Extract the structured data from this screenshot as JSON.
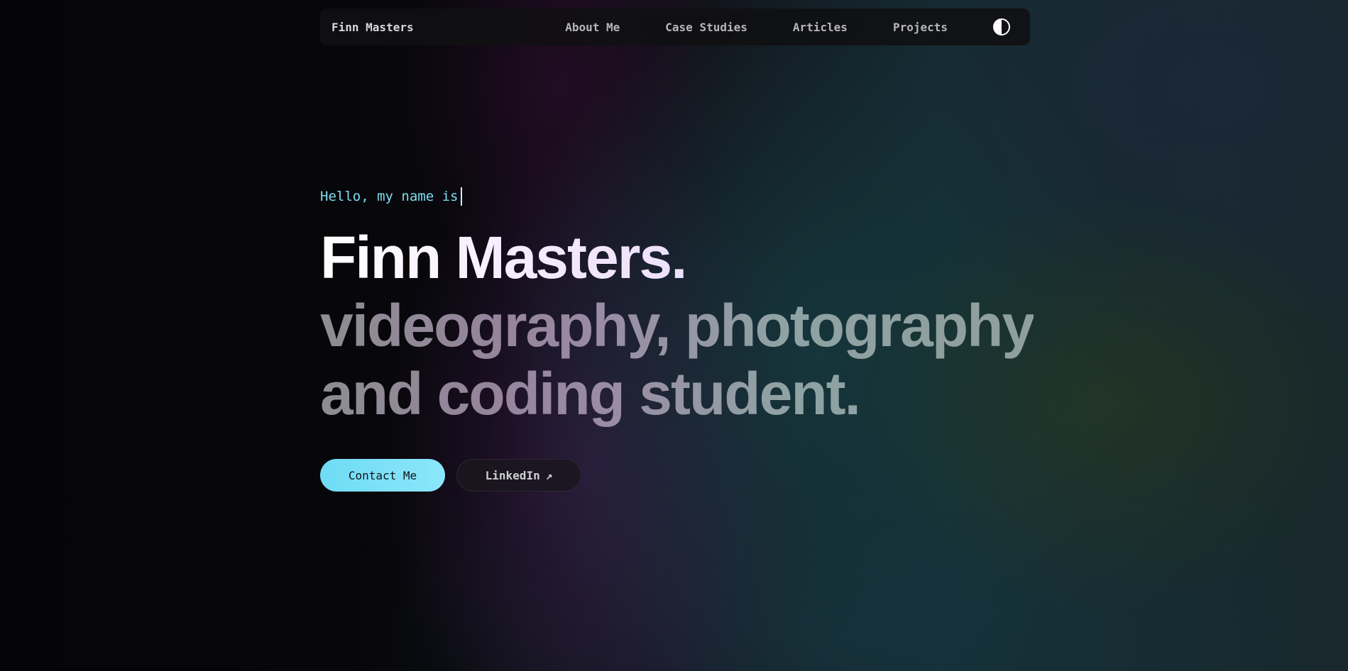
{
  "nav": {
    "brand": "Finn Masters",
    "links": [
      {
        "label": "About Me"
      },
      {
        "label": "Case Studies"
      },
      {
        "label": "Articles"
      },
      {
        "label": "Projects"
      }
    ],
    "theme_toggle_icon": "half-circle-contrast-icon"
  },
  "hero": {
    "greeting": "Hello, my name is",
    "name": "Finn Masters.",
    "tagline_line1": "videography, photography",
    "tagline_line2": "and coding student."
  },
  "actions": {
    "contact_label": "Contact Me",
    "linkedin_label": "LinkedIn",
    "linkedin_arrow": "↗"
  },
  "colors": {
    "accent": "#7fdcf0",
    "background": "#060608"
  }
}
